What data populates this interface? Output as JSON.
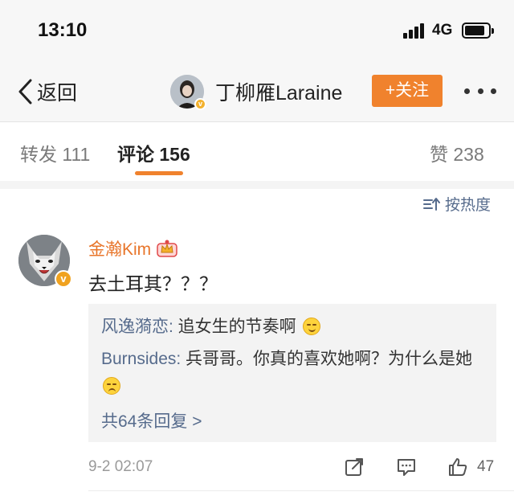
{
  "status_bar": {
    "time": "13:10",
    "network": "4G"
  },
  "nav": {
    "back_label": "返回",
    "username": "丁柳雁Laraine",
    "follow_label": "+关注",
    "more_icon": "more-dots-icon"
  },
  "tabs": [
    {
      "label": "转发 111"
    },
    {
      "label": "评论 156"
    },
    {
      "label": "赞 238"
    }
  ],
  "sort_label": "按热度",
  "comment": {
    "username": "金瀚Kim",
    "text": "去土耳其？？？",
    "time": "9-2 02:07",
    "like_count": "47",
    "replies": [
      {
        "name": "风逸漪恋:",
        "text": " 追女生的节奏啊",
        "emoji": "smile-emoji"
      },
      {
        "name": "Burnsides:",
        "text": " 兵哥哥。你真的喜欢她啊？为什么是她",
        "emoji": "sad-emoji"
      }
    ],
    "more_replies": "共64条回复 >"
  },
  "colors": {
    "accent": "#f0822d",
    "link": "#566b8c",
    "username": "#e8752a"
  }
}
